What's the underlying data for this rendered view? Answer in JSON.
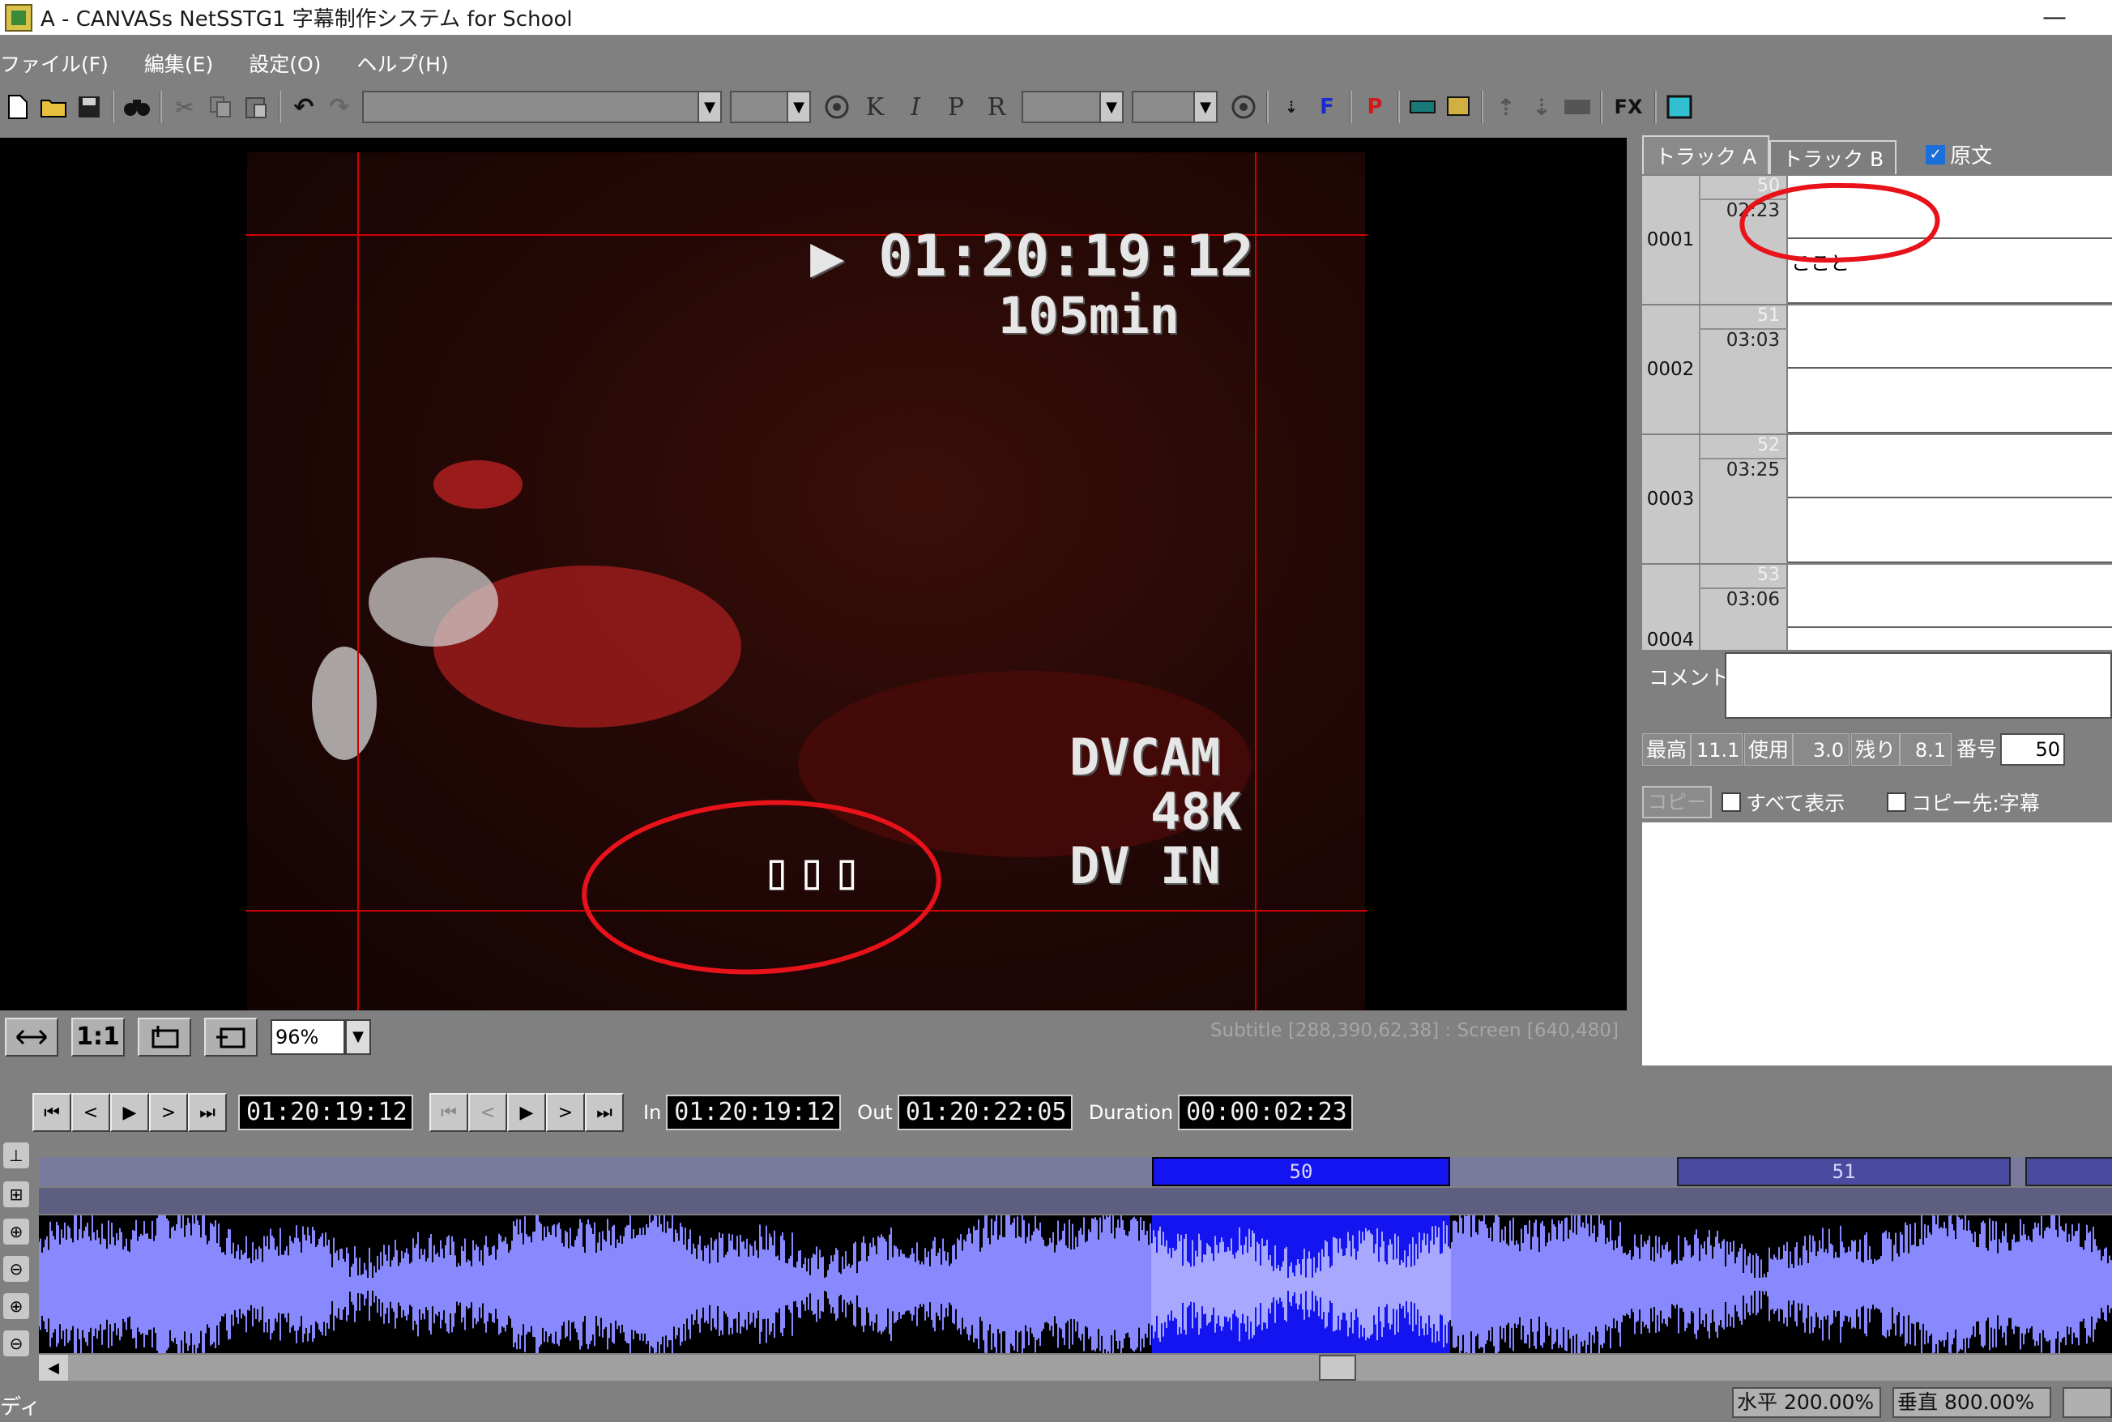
{
  "window": {
    "title": "A - CANVASs NetSSTG1 字幕制作システム for School",
    "minimize": "—"
  },
  "menu": [
    "ファイル(F)",
    "編集(E)",
    "設定(O)",
    "ヘルプ(H)"
  ],
  "toolbar": {
    "fx_label": "FX",
    "style_letters": [
      "K",
      "I",
      "P",
      "R"
    ]
  },
  "video": {
    "timecode": "▶ 01:20:19:12",
    "tape": "105min",
    "format_lines": [
      "DVCAM",
      "48K",
      "DV IN"
    ],
    "subtitle_preview": "▯▯▯"
  },
  "video_bar": {
    "ratio_label": "1:1",
    "zoom": "96%",
    "subtitle_info": "Subtitle [288,390,62,38] : Screen [640,480]"
  },
  "tracks": {
    "tab_a": "トラック A",
    "tab_b": "トラック B",
    "original_label": "原文",
    "original_checked": true
  },
  "subtitles": [
    {
      "num": "0001",
      "orig_index": "50",
      "duration": "02:23",
      "line1": "",
      "line2": "ここと"
    },
    {
      "num": "0002",
      "orig_index": "51",
      "duration": "03:03",
      "line1": "",
      "line2": ""
    },
    {
      "num": "0003",
      "orig_index": "52",
      "duration": "03:25",
      "line1": "",
      "line2": ""
    },
    {
      "num": "0004",
      "orig_index": "53",
      "duration": "03:06",
      "line1": "",
      "line2": ""
    }
  ],
  "comment": {
    "label": "コメント",
    "value": ""
  },
  "stats": {
    "max_label": "最高",
    "max_value": "11.1",
    "used_label": "使用",
    "used_value": "3.0",
    "remain_label": "残り",
    "remain_value": "8.1",
    "number_label": "番号",
    "number_value": "50"
  },
  "copy": {
    "button": "コピー",
    "show_all": "すべて表示",
    "copy_to": "コピー先:字幕"
  },
  "transport": {
    "current": "01:20:19:12",
    "in_label": "In",
    "in_value": "01:20:19:12",
    "out_label": "Out",
    "out_value": "01:20:22:05",
    "duration_label": "Duration",
    "duration_value": "00:00:02:23"
  },
  "timeline": {
    "blocks": [
      "50",
      "51"
    ]
  },
  "status": {
    "left": "ディ",
    "horizontal": "水平 200.00%",
    "vertical": "垂直 800.00%"
  },
  "colors": {
    "background": "#808080",
    "guide": "#d00000",
    "annotation": "#e8121a",
    "selected_block": "#1414f0",
    "waveform": "#8888ff",
    "waveform_selected": "#a8a8ff"
  }
}
